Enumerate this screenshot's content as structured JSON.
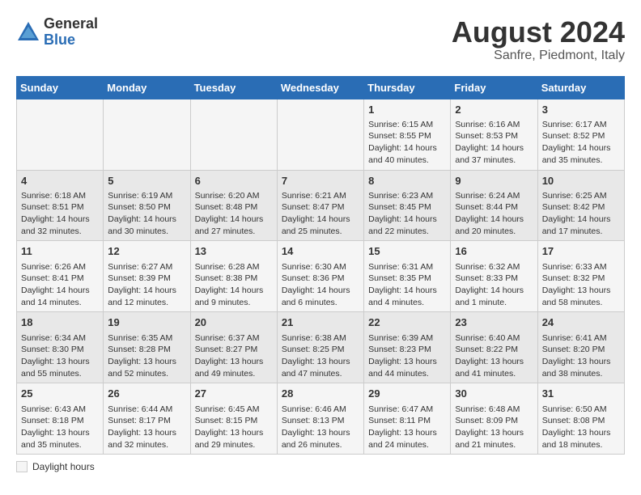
{
  "header": {
    "logo_general": "General",
    "logo_blue": "Blue",
    "title": "August 2024",
    "subtitle": "Sanfre, Piedmont, Italy"
  },
  "calendar": {
    "days_of_week": [
      "Sunday",
      "Monday",
      "Tuesday",
      "Wednesday",
      "Thursday",
      "Friday",
      "Saturday"
    ],
    "weeks": [
      [
        {
          "day": "",
          "info": ""
        },
        {
          "day": "",
          "info": ""
        },
        {
          "day": "",
          "info": ""
        },
        {
          "day": "",
          "info": ""
        },
        {
          "day": "1",
          "info": "Sunrise: 6:15 AM\nSunset: 8:55 PM\nDaylight: 14 hours and 40 minutes."
        },
        {
          "day": "2",
          "info": "Sunrise: 6:16 AM\nSunset: 8:53 PM\nDaylight: 14 hours and 37 minutes."
        },
        {
          "day": "3",
          "info": "Sunrise: 6:17 AM\nSunset: 8:52 PM\nDaylight: 14 hours and 35 minutes."
        }
      ],
      [
        {
          "day": "4",
          "info": "Sunrise: 6:18 AM\nSunset: 8:51 PM\nDaylight: 14 hours and 32 minutes."
        },
        {
          "day": "5",
          "info": "Sunrise: 6:19 AM\nSunset: 8:50 PM\nDaylight: 14 hours and 30 minutes."
        },
        {
          "day": "6",
          "info": "Sunrise: 6:20 AM\nSunset: 8:48 PM\nDaylight: 14 hours and 27 minutes."
        },
        {
          "day": "7",
          "info": "Sunrise: 6:21 AM\nSunset: 8:47 PM\nDaylight: 14 hours and 25 minutes."
        },
        {
          "day": "8",
          "info": "Sunrise: 6:23 AM\nSunset: 8:45 PM\nDaylight: 14 hours and 22 minutes."
        },
        {
          "day": "9",
          "info": "Sunrise: 6:24 AM\nSunset: 8:44 PM\nDaylight: 14 hours and 20 minutes."
        },
        {
          "day": "10",
          "info": "Sunrise: 6:25 AM\nSunset: 8:42 PM\nDaylight: 14 hours and 17 minutes."
        }
      ],
      [
        {
          "day": "11",
          "info": "Sunrise: 6:26 AM\nSunset: 8:41 PM\nDaylight: 14 hours and 14 minutes."
        },
        {
          "day": "12",
          "info": "Sunrise: 6:27 AM\nSunset: 8:39 PM\nDaylight: 14 hours and 12 minutes."
        },
        {
          "day": "13",
          "info": "Sunrise: 6:28 AM\nSunset: 8:38 PM\nDaylight: 14 hours and 9 minutes."
        },
        {
          "day": "14",
          "info": "Sunrise: 6:30 AM\nSunset: 8:36 PM\nDaylight: 14 hours and 6 minutes."
        },
        {
          "day": "15",
          "info": "Sunrise: 6:31 AM\nSunset: 8:35 PM\nDaylight: 14 hours and 4 minutes."
        },
        {
          "day": "16",
          "info": "Sunrise: 6:32 AM\nSunset: 8:33 PM\nDaylight: 14 hours and 1 minute."
        },
        {
          "day": "17",
          "info": "Sunrise: 6:33 AM\nSunset: 8:32 PM\nDaylight: 13 hours and 58 minutes."
        }
      ],
      [
        {
          "day": "18",
          "info": "Sunrise: 6:34 AM\nSunset: 8:30 PM\nDaylight: 13 hours and 55 minutes."
        },
        {
          "day": "19",
          "info": "Sunrise: 6:35 AM\nSunset: 8:28 PM\nDaylight: 13 hours and 52 minutes."
        },
        {
          "day": "20",
          "info": "Sunrise: 6:37 AM\nSunset: 8:27 PM\nDaylight: 13 hours and 49 minutes."
        },
        {
          "day": "21",
          "info": "Sunrise: 6:38 AM\nSunset: 8:25 PM\nDaylight: 13 hours and 47 minutes."
        },
        {
          "day": "22",
          "info": "Sunrise: 6:39 AM\nSunset: 8:23 PM\nDaylight: 13 hours and 44 minutes."
        },
        {
          "day": "23",
          "info": "Sunrise: 6:40 AM\nSunset: 8:22 PM\nDaylight: 13 hours and 41 minutes."
        },
        {
          "day": "24",
          "info": "Sunrise: 6:41 AM\nSunset: 8:20 PM\nDaylight: 13 hours and 38 minutes."
        }
      ],
      [
        {
          "day": "25",
          "info": "Sunrise: 6:43 AM\nSunset: 8:18 PM\nDaylight: 13 hours and 35 minutes."
        },
        {
          "day": "26",
          "info": "Sunrise: 6:44 AM\nSunset: 8:17 PM\nDaylight: 13 hours and 32 minutes."
        },
        {
          "day": "27",
          "info": "Sunrise: 6:45 AM\nSunset: 8:15 PM\nDaylight: 13 hours and 29 minutes."
        },
        {
          "day": "28",
          "info": "Sunrise: 6:46 AM\nSunset: 8:13 PM\nDaylight: 13 hours and 26 minutes."
        },
        {
          "day": "29",
          "info": "Sunrise: 6:47 AM\nSunset: 8:11 PM\nDaylight: 13 hours and 24 minutes."
        },
        {
          "day": "30",
          "info": "Sunrise: 6:48 AM\nSunset: 8:09 PM\nDaylight: 13 hours and 21 minutes."
        },
        {
          "day": "31",
          "info": "Sunrise: 6:50 AM\nSunset: 8:08 PM\nDaylight: 13 hours and 18 minutes."
        }
      ]
    ]
  },
  "legend": {
    "box_label": "Daylight hours"
  }
}
